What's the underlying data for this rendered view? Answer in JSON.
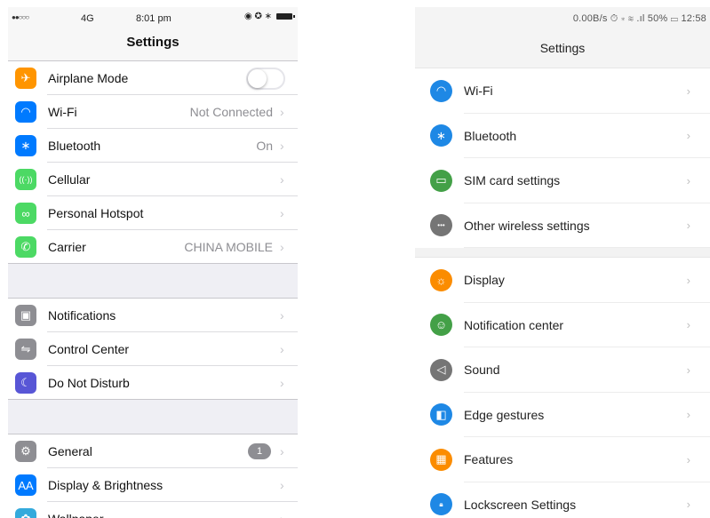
{
  "ios": {
    "status": {
      "signal": "●●○○○",
      "network": "4G",
      "time": "8:01 pm",
      "right_icons": "◉ ✪ ∗"
    },
    "title": "Settings",
    "groups": [
      [
        {
          "label": "Airplane Mode",
          "icon": "airplane-icon",
          "glyph": "✈",
          "color": "#ff9500",
          "toggle": true,
          "toggle_on": false
        },
        {
          "label": "Wi-Fi",
          "icon": "wifi-icon",
          "glyph": "◠",
          "color": "#007aff",
          "detail": "Not Connected"
        },
        {
          "label": "Bluetooth",
          "icon": "bluetooth-icon",
          "glyph": "∗",
          "color": "#007aff",
          "detail": "On"
        },
        {
          "label": "Cellular",
          "icon": "cellular-icon",
          "glyph": "((·))",
          "color": "#4cd964"
        },
        {
          "label": "Personal Hotspot",
          "icon": "hotspot-icon",
          "glyph": "∞",
          "color": "#4cd964"
        },
        {
          "label": "Carrier",
          "icon": "phone-icon",
          "glyph": "✆",
          "color": "#4cd964",
          "detail": "CHINA MOBILE"
        }
      ],
      [
        {
          "label": "Notifications",
          "icon": "notifications-icon",
          "glyph": "▣",
          "color": "#8e8e93"
        },
        {
          "label": "Control Center",
          "icon": "control-center-icon",
          "glyph": "⇋",
          "color": "#8e8e93"
        },
        {
          "label": "Do Not Disturb",
          "icon": "moon-icon",
          "glyph": "☾",
          "color": "#5856d6"
        }
      ],
      [
        {
          "label": "General",
          "icon": "gear-icon",
          "glyph": "⚙",
          "color": "#8e8e93",
          "badge": "1"
        },
        {
          "label": "Display & Brightness",
          "icon": "display-brightness-icon",
          "glyph": "AA",
          "color": "#007aff"
        },
        {
          "label": "Wallpaper",
          "icon": "wallpaper-icon",
          "glyph": "✿",
          "color": "#34aadc"
        }
      ]
    ],
    "chevron": "›"
  },
  "android": {
    "status": {
      "text": "0.00B/s ⏱ ∗ ≋ .ıl 50% ▭ 12:58"
    },
    "title": "Settings",
    "groups": [
      [
        {
          "label": "Wi-Fi",
          "icon": "wifi-icon",
          "glyph": "◠",
          "color": "#1e88e5"
        },
        {
          "label": "Bluetooth",
          "icon": "bluetooth-icon",
          "glyph": "∗",
          "color": "#1e88e5"
        },
        {
          "label": "SIM card settings",
          "icon": "sim-card-icon",
          "glyph": "▭",
          "color": "#43a047"
        },
        {
          "label": "Other wireless settings",
          "icon": "more-icon",
          "glyph": "•••",
          "color": "#757575"
        }
      ],
      [
        {
          "label": "Display",
          "icon": "brightness-icon",
          "glyph": "☼",
          "color": "#fb8c00"
        },
        {
          "label": "Notification center",
          "icon": "chat-bubble-icon",
          "glyph": "☺",
          "color": "#43a047"
        },
        {
          "label": "Sound",
          "icon": "speaker-icon",
          "glyph": "◁",
          "color": "#757575"
        },
        {
          "label": "Edge gestures",
          "icon": "edge-gestures-icon",
          "glyph": "◧",
          "color": "#1e88e5"
        },
        {
          "label": "Features",
          "icon": "features-icon",
          "glyph": "▦",
          "color": "#fb8c00"
        },
        {
          "label": "Lockscreen Settings",
          "icon": "lock-icon",
          "glyph": "🔒︎",
          "color": "#1e88e5"
        }
      ]
    ],
    "chevron": "›"
  }
}
